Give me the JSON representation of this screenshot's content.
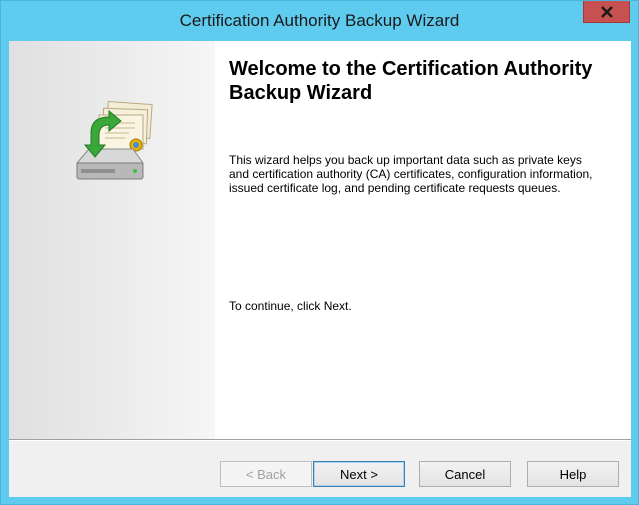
{
  "window": {
    "title": "Certification Authority Backup Wizard"
  },
  "content": {
    "heading": "Welcome to the Certification Authority Backup Wizard",
    "description": "This wizard helps you back up important data such as private keys and certification authority (CA) certificates, configuration information, issued certificate log, and pending certificate requests queues.",
    "continue_text": "To continue, click Next."
  },
  "buttons": {
    "back": "< Back",
    "next": "Next >",
    "cancel": "Cancel",
    "help": "Help"
  },
  "icons": {
    "close": "close-icon",
    "graphic": "backup-wizard-graphic-icon"
  },
  "colors": {
    "frame": "#5fcbee",
    "close_button": "#c75050",
    "default_button_border": "#3c7fb1"
  }
}
